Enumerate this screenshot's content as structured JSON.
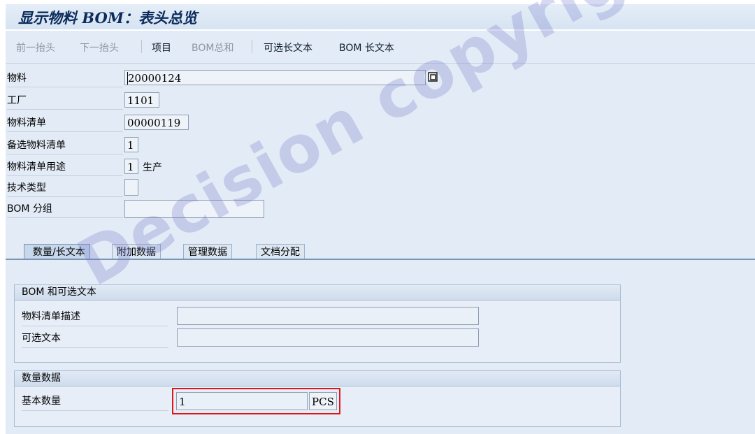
{
  "title": "显示物料 BOM：表头总览",
  "toolbar": {
    "prev_header": "前一抬头",
    "next_header": "下一抬头",
    "items": "项目",
    "bom_total": "BOM总和",
    "alt_long_text": "可选长文本",
    "bom_long_text": "BOM 长文本"
  },
  "header": {
    "material_label": "物料",
    "material_value": "20000124",
    "plant_label": "工厂",
    "plant_value": "1101",
    "bom_label": "物料清单",
    "bom_value": "00000119",
    "alt_bom_label": "备选物料清单",
    "alt_bom_value": "1",
    "usage_label": "物料清单用途",
    "usage_value": "1",
    "usage_text": "生产",
    "tech_type_label": "技术类型",
    "tech_type_value": "",
    "bom_group_label": "BOM 分组",
    "bom_group_value": ""
  },
  "tabs": [
    "数量/长文本",
    "附加数据",
    "管理数据",
    "文档分配"
  ],
  "groups": {
    "bom_text": {
      "title": "BOM 和可选文本",
      "desc_label": "物料清单描述",
      "desc_value": "",
      "alt_text_label": "可选文本",
      "alt_text_value": ""
    },
    "quantity": {
      "title": "数量数据",
      "base_qty_label": "基本数量",
      "base_qty_value": "1",
      "unit_value": "PCS"
    }
  },
  "watermark": "Decision copyright"
}
